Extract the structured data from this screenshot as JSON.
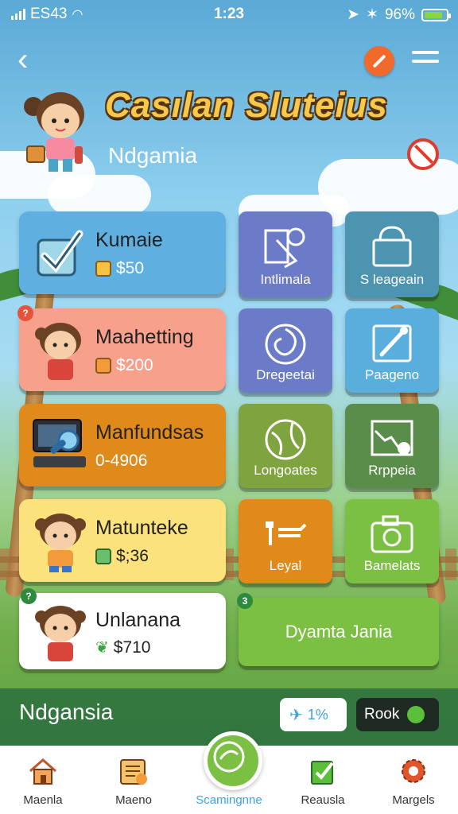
{
  "status": {
    "carrier": "ES43",
    "time": "1:23",
    "battery": "96%"
  },
  "header": {
    "title": "Casılan Sluteius",
    "subtitle": "Ndgamia"
  },
  "cards": [
    {
      "label": "Kumaie",
      "price": "$50",
      "color": "#5fb0e0"
    },
    {
      "label": "Maahetting",
      "price": "$200",
      "color": "#f7a08c"
    },
    {
      "label": "Manfundsas",
      "price": "0-4906",
      "color": "#e08a1c"
    },
    {
      "label": "Matunteke",
      "price": "$;36",
      "color": "#fbe27c"
    },
    {
      "label": "Unlanana",
      "price": "$710",
      "color": "#ffffff"
    }
  ],
  "tiles": [
    {
      "label": "Intlimala",
      "icon": "puzzle-icon",
      "color": "#6b7bc8"
    },
    {
      "label": "S leageain",
      "icon": "bag-icon",
      "color": "#4d94b0"
    },
    {
      "label": "Dregeetai",
      "icon": "swirl-icon",
      "color": "#6b7bc8"
    },
    {
      "label": "Paageno",
      "icon": "pencil-icon",
      "color": "#5aaedb"
    },
    {
      "label": "Longoates",
      "icon": "globe-icon",
      "color": "#7fa33f"
    },
    {
      "label": "Rrppeia",
      "icon": "map-icon",
      "color": "#5a8c4a"
    },
    {
      "label": "Leyal",
      "icon": "sign-icon",
      "color": "#e08a1c"
    },
    {
      "label": "Bamelats",
      "icon": "camera-icon",
      "color": "#7cc043"
    }
  ],
  "wide_button": {
    "label": "Dyamta Jania"
  },
  "badges": {
    "card2": "?",
    "card5": "?",
    "wide": "3"
  },
  "bottom": {
    "title": "Ndgansia",
    "twitter_count": "1%",
    "rook_label": "Rook"
  },
  "nav": [
    {
      "label": "Maenla",
      "icon": "home-icon"
    },
    {
      "label": "Maeno",
      "icon": "calendar-icon"
    },
    {
      "label": "Scamingnne",
      "icon": "scan-icon"
    },
    {
      "label": "Reausla",
      "icon": "checklist-icon"
    },
    {
      "label": "Margels",
      "icon": "settings-icon"
    }
  ]
}
